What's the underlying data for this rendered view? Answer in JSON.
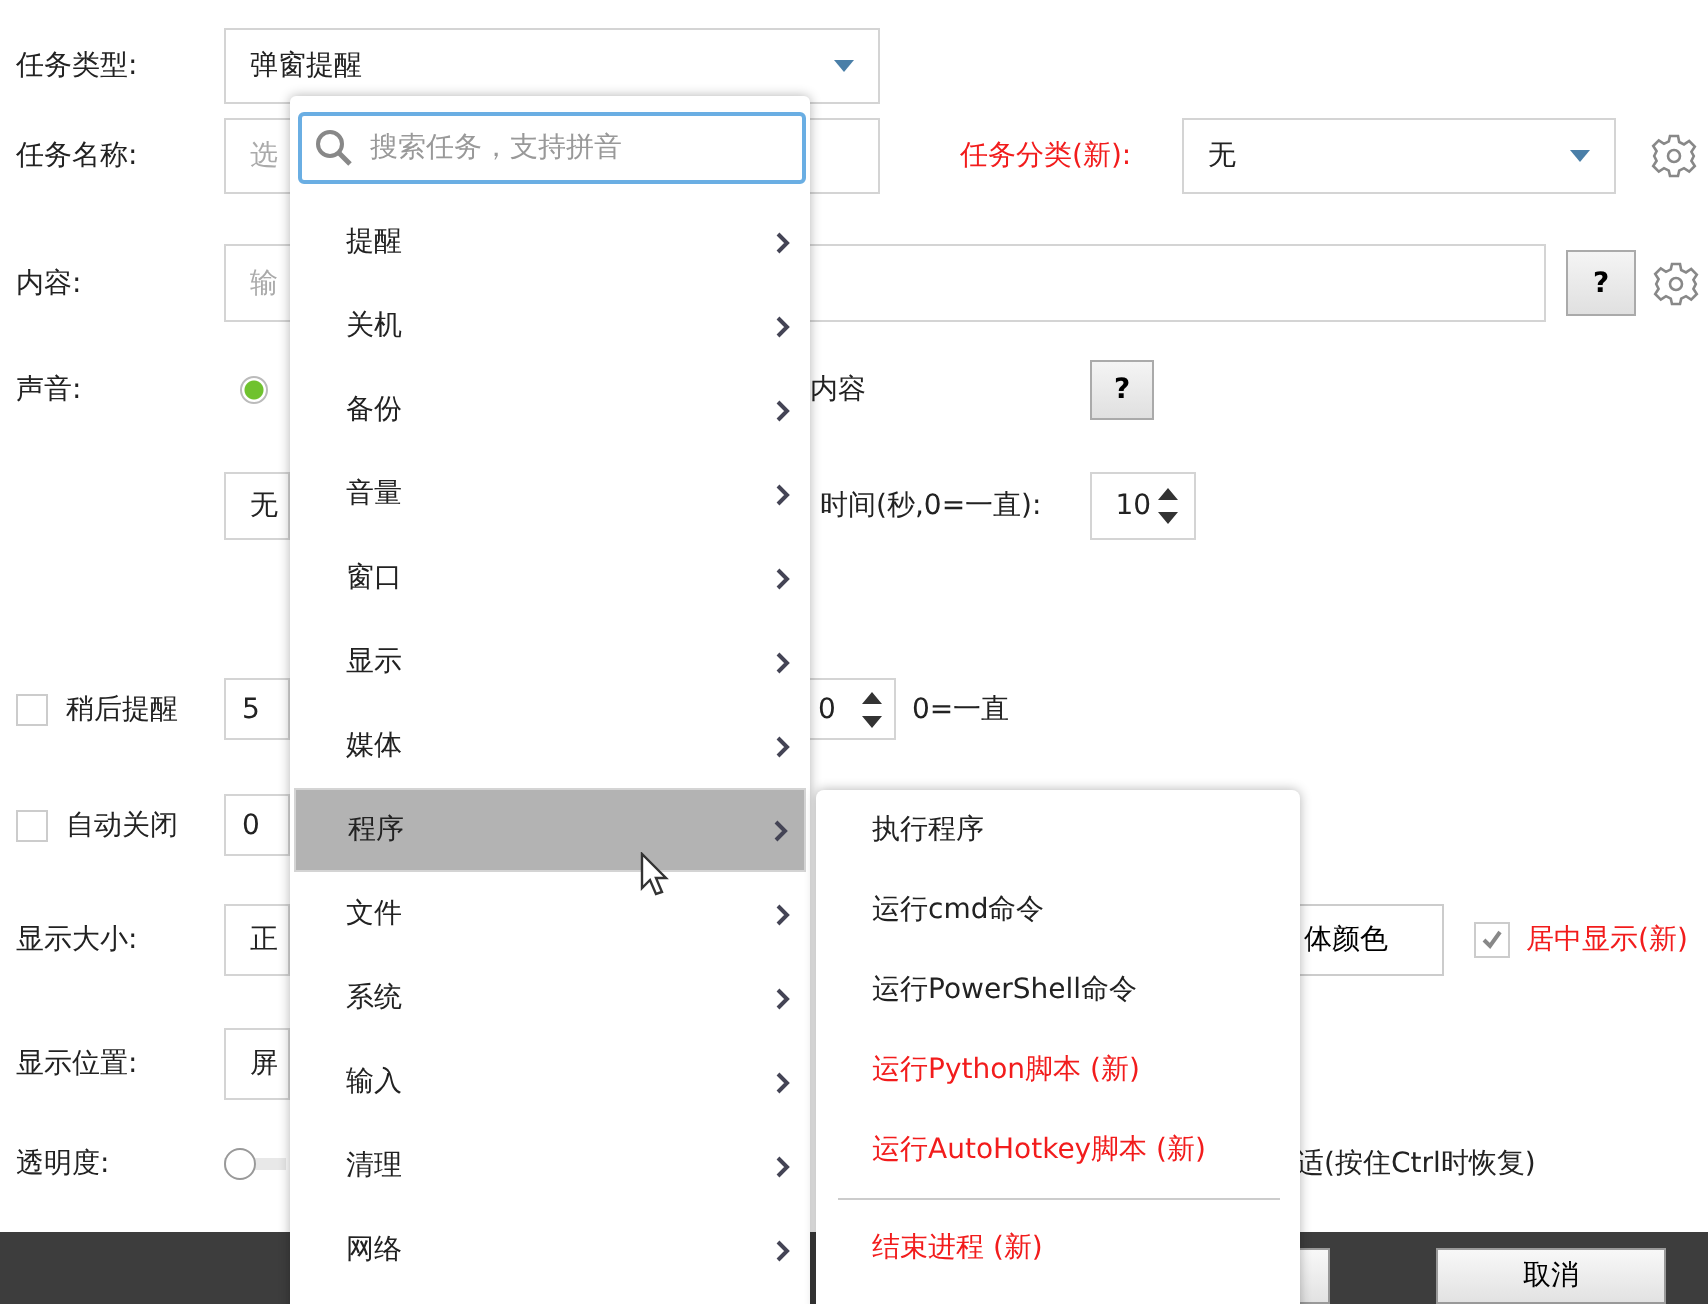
{
  "form": {
    "task_type": {
      "label": "任务类型:",
      "value": "弹窗提醒"
    },
    "task_name": {
      "label": "任务名称:",
      "placeholder": "选"
    },
    "category": {
      "label": "任务分类(新):",
      "value": "无"
    },
    "content": {
      "label": "内容:",
      "placeholder": "输",
      "help": "?"
    },
    "sound": {
      "label": "声音:",
      "radio_selected": true,
      "option_text": "内容",
      "help": "?"
    },
    "sound_file": {
      "value": "无",
      "duration_label": "时间(秒,0=一直):",
      "duration": "10"
    },
    "snooze": {
      "checked": false,
      "label": "稍后提醒",
      "value": "5",
      "spin_value": "0",
      "note": "0=一直"
    },
    "auto_close": {
      "checked": false,
      "label": "自动关闭",
      "value": "0"
    },
    "size": {
      "label": "显示大小:",
      "value": "正",
      "font_color_button": "体颜色",
      "center_checked": true,
      "center_label": "居中显示(新)"
    },
    "position": {
      "label": "显示位置:",
      "value": "屏"
    },
    "opacity": {
      "label": "透明度:",
      "level": 0,
      "note": "适(按住Ctrl时恢复)"
    }
  },
  "buttons": [
    {
      "label": "取消"
    }
  ],
  "menu": {
    "search_placeholder": "搜索任务，支持拼音",
    "items": [
      {
        "label": "提醒",
        "selected": false
      },
      {
        "label": "关机",
        "selected": false
      },
      {
        "label": "备份",
        "selected": false
      },
      {
        "label": "音量",
        "selected": false
      },
      {
        "label": "窗口",
        "selected": false
      },
      {
        "label": "显示",
        "selected": false
      },
      {
        "label": "媒体",
        "selected": false
      },
      {
        "label": "程序",
        "selected": true
      },
      {
        "label": "文件",
        "selected": false
      },
      {
        "label": "系统",
        "selected": false
      },
      {
        "label": "输入",
        "selected": false
      },
      {
        "label": "清理",
        "selected": false
      },
      {
        "label": "网络",
        "selected": false
      }
    ]
  },
  "submenu": {
    "items": [
      {
        "label": "执行程序",
        "highlight": false,
        "divider_before": false
      },
      {
        "label": "运行cmd命令",
        "highlight": false,
        "divider_before": false
      },
      {
        "label": "运行PowerShell命令",
        "highlight": false,
        "divider_before": false
      },
      {
        "label": "运行Python脚本 (新)",
        "highlight": true,
        "divider_before": false
      },
      {
        "label": "运行AutoHotkey脚本 (新)",
        "highlight": true,
        "divider_before": false
      },
      {
        "label": "结束进程 (新)",
        "highlight": true,
        "divider_before": true
      }
    ]
  }
}
